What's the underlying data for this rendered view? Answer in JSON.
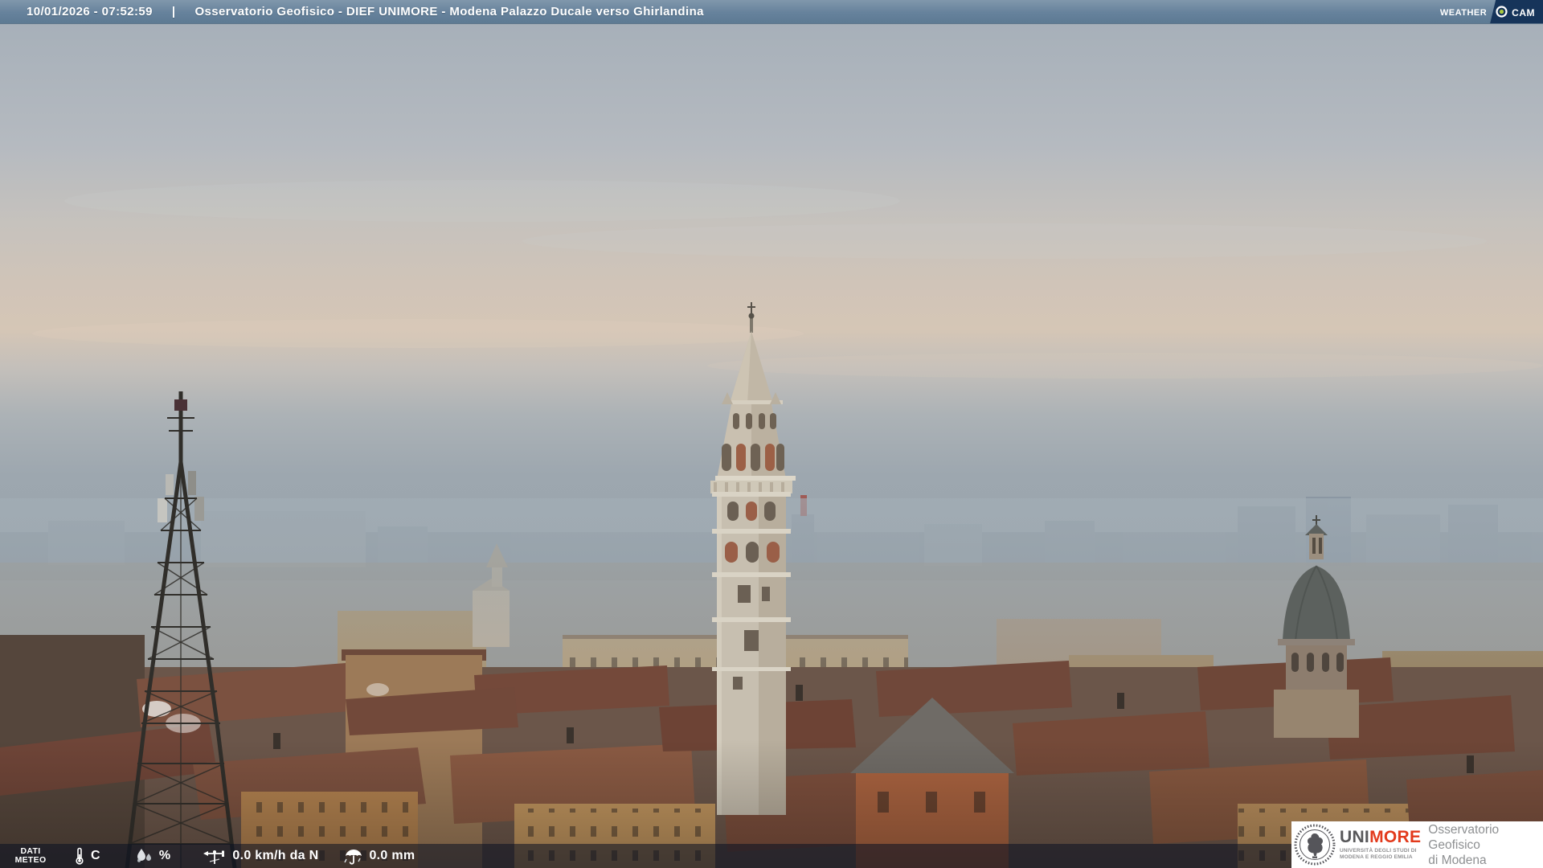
{
  "top_bar": {
    "timestamp": "10/01/2026 - 07:52:59",
    "separator": "|",
    "title": "Osservatorio Geofisico - DIEF UNIMORE - Modena Palazzo Ducale verso Ghirlandina"
  },
  "weathercam": {
    "weather": "Weather",
    "cam": "Cam"
  },
  "bottom_bar": {
    "panel_label": [
      "DATI",
      "METEO"
    ],
    "readings": [
      {
        "icon": "thermometer-icon",
        "text": "C"
      },
      {
        "icon": "humidity-drops-icon",
        "text": "%"
      },
      {
        "icon": "wind-vane-icon",
        "text": "0.0 km/h da N"
      },
      {
        "icon": "umbrella-rain-icon",
        "text": "0.0 mm"
      }
    ]
  },
  "logo_box": {
    "uni": "UNI",
    "more": "MORE",
    "subtitle_line1": "UNIVERSITÀ DEGLI STUDI DI",
    "subtitle_line2": "MODENA E REGGIO EMILIA",
    "org_line1": "Osservatorio Geofisico",
    "org_line2": "di Modena"
  },
  "colors": {
    "top_bar_blue": "#66829c",
    "weathercam_navy": "#16345a",
    "weathercam_dot_green": "#a9c93f",
    "bottom_bar_overlay": "rgba(10,16,34,0.55)",
    "unimore_red": "#e23a1c",
    "logo_text_gray": "#8e9092",
    "sky_top": "#a4aeb8",
    "sky_pink_band": "#d5c6b6",
    "haze_blue": "#9aa5ad",
    "roof_terracotta": "#7d4e3c"
  }
}
